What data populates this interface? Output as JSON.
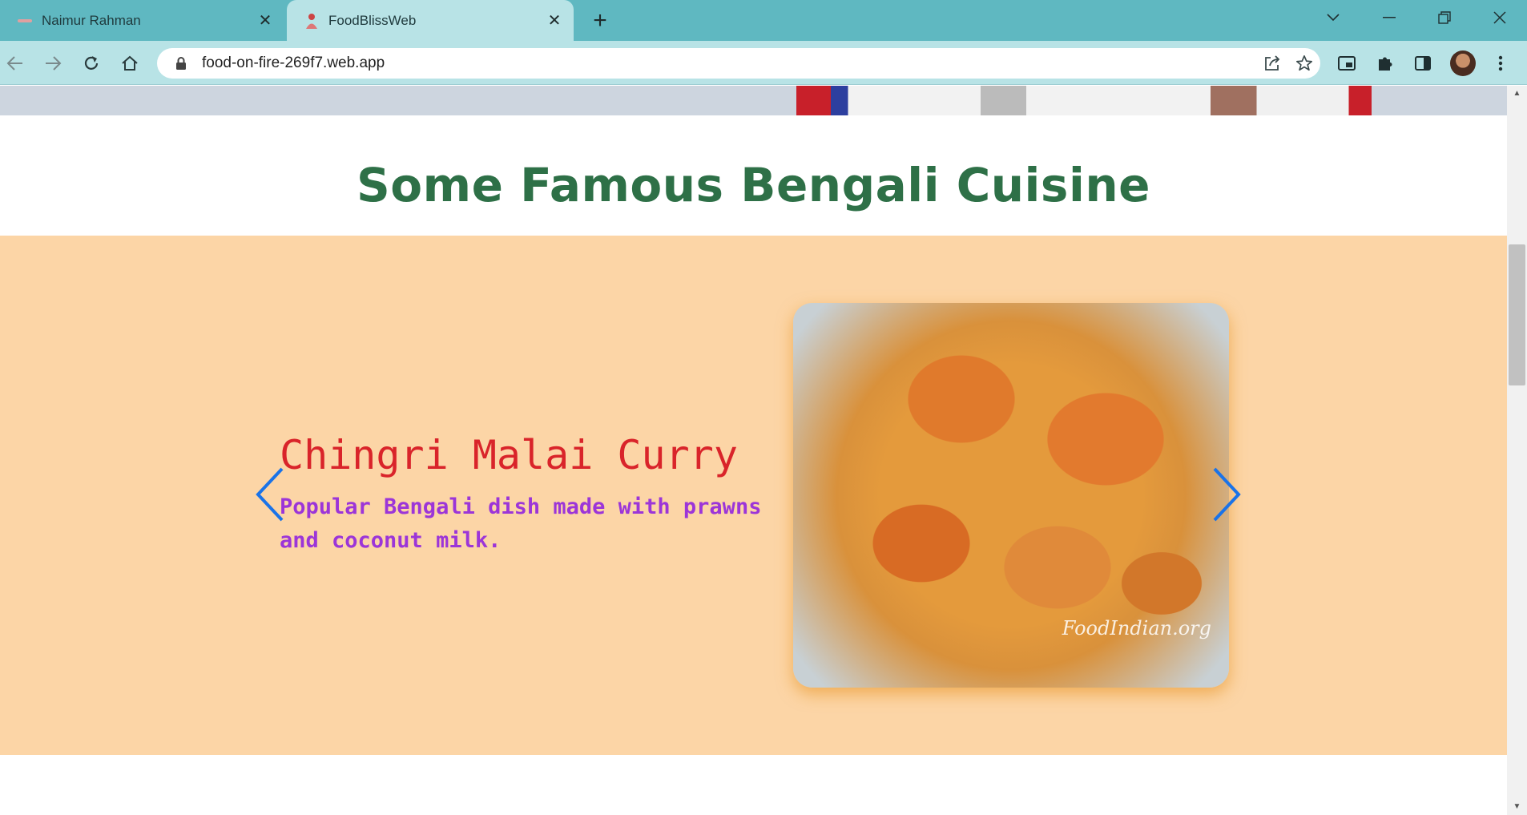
{
  "browser": {
    "tabs": [
      {
        "label": "Naimur Rahman",
        "active": false
      },
      {
        "label": "FoodBlissWeb",
        "active": true
      }
    ],
    "url": "food-on-fire-269f7.web.app",
    "icons": {
      "back": "arrow-left-icon",
      "forward": "arrow-right-icon",
      "reload": "reload-icon",
      "home": "home-icon",
      "lock": "lock-icon",
      "share": "share-icon",
      "bookmark": "star-icon",
      "pip": "picture-in-picture-icon",
      "extensions": "puzzle-icon",
      "sidepanel": "side-panel-icon",
      "menu": "kebab-menu-icon"
    },
    "colors": {
      "tabstrip": "#5fb8c1",
      "toolbar": "#b8e3e6"
    }
  },
  "page": {
    "section_title": "Some Famous Bengali Cuisine",
    "carousel": {
      "slides": [
        {
          "name": "Chingri Malai Curry",
          "description": "Popular Bengali dish made with prawns and coconut milk.",
          "image_watermark": "FoodIndian.org"
        }
      ],
      "prev_icon": "chevron-left-icon",
      "next_icon": "chevron-right-icon"
    },
    "colors": {
      "title": "#2e7047",
      "carousel_bg": "#fcd5a6",
      "dish_name": "#d9242a",
      "dish_desc": "#9c35d8",
      "arrows": "#1a73e8"
    }
  }
}
